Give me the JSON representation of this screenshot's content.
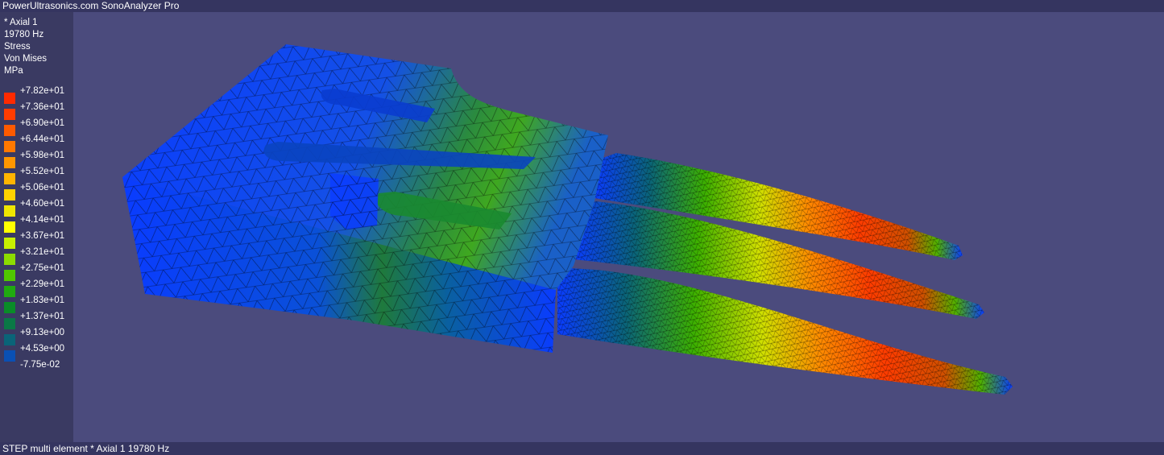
{
  "window": {
    "title": "PowerUltrasonics.com SonoAnalyzer Pro"
  },
  "info": {
    "mode": "* Axial 1",
    "frequency": "19780 Hz",
    "result_type": "Stress",
    "component": "Von Mises",
    "unit": "MPa"
  },
  "legend": {
    "items": [
      {
        "label": "+7.82e+01",
        "color": "#ff2a00"
      },
      {
        "label": "+7.36e+01",
        "color": "#ff3c00"
      },
      {
        "label": "+6.90e+01",
        "color": "#ff5a00"
      },
      {
        "label": "+6.44e+01",
        "color": "#ff7800"
      },
      {
        "label": "+5.98e+01",
        "color": "#ff9600"
      },
      {
        "label": "+5.52e+01",
        "color": "#ffb400"
      },
      {
        "label": "+5.06e+01",
        "color": "#ffd200"
      },
      {
        "label": "+4.60e+01",
        "color": "#f0e600"
      },
      {
        "label": "+4.14e+01",
        "color": "#ffff00"
      },
      {
        "label": "+3.67e+01",
        "color": "#c8f000"
      },
      {
        "label": "+3.21e+01",
        "color": "#8cdc00"
      },
      {
        "label": "+2.75e+01",
        "color": "#50c800"
      },
      {
        "label": "+2.29e+01",
        "color": "#20aa10"
      },
      {
        "label": "+1.83e+01",
        "color": "#0a8c28"
      },
      {
        "label": "+1.37e+01",
        "color": "#0a7846"
      },
      {
        "label": "+9.13e+00",
        "color": "#0a6478"
      },
      {
        "label": "+4.53e+00",
        "color": "#0a50b4"
      },
      {
        "label": "-7.75e-02",
        "color": "#0a3cff"
      }
    ]
  },
  "status": {
    "text": "STEP multi element * Axial 1 19780 Hz"
  }
}
